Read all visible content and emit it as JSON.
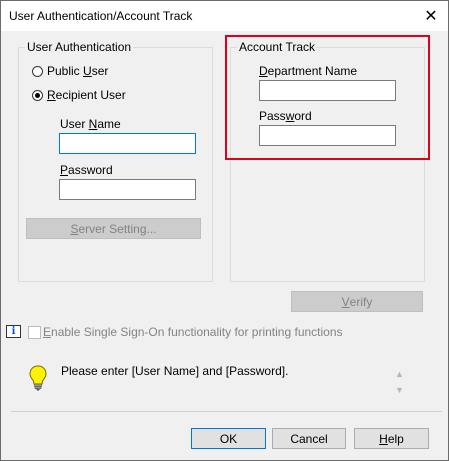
{
  "window": {
    "title": "User Authentication/Account Track",
    "close_glyph": "✕"
  },
  "user_auth": {
    "legend": "User Authentication",
    "public_user": {
      "label_pre": "Public ",
      "label_u": "U",
      "label_post": "ser",
      "selected": false
    },
    "recipient_user": {
      "label_pre": "",
      "label_u": "R",
      "label_post": "ecipient User",
      "selected": true
    },
    "user_name": {
      "label_pre": "User ",
      "label_u": "N",
      "label_post": "ame",
      "value": ""
    },
    "password": {
      "label_pre": "",
      "label_u": "P",
      "label_post": "assword",
      "value": ""
    },
    "server_setting": {
      "label_pre": "",
      "label_u": "S",
      "label_post": "erver Setting..."
    }
  },
  "account_track": {
    "legend": "Account Track",
    "department_name": {
      "label_pre": "",
      "label_u": "D",
      "label_post": "epartment Name",
      "value": ""
    },
    "password": {
      "label_pre": "Pass",
      "label_u": "w",
      "label_post": "ord",
      "value": ""
    }
  },
  "verify": {
    "label_pre": "",
    "label_u": "V",
    "label_post": "erify"
  },
  "sso": {
    "label_pre": "",
    "label_u": "E",
    "label_post": "nable Single Sign-On functionality for printing functions",
    "checked": false
  },
  "message": {
    "text": "Please enter [User Name] and [Password]."
  },
  "footer": {
    "ok": "OK",
    "cancel": "Cancel",
    "help": {
      "label_pre": "",
      "label_u": "H",
      "label_post": "elp"
    }
  },
  "colors": {
    "highlight": "#e0001b",
    "focus": "#0078d7"
  },
  "icons": {
    "info": "info-icon",
    "bulb": "lightbulb-icon"
  }
}
